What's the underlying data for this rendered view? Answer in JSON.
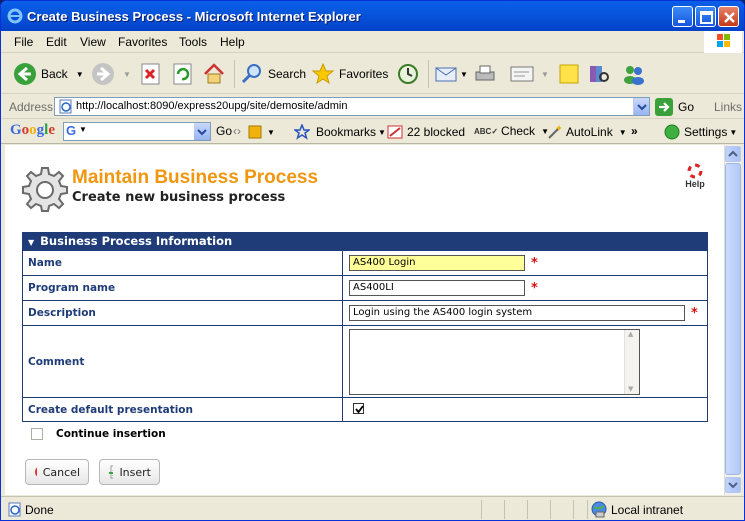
{
  "window": {
    "title": "Create Business Process - Microsoft Internet Explorer"
  },
  "menu": [
    "File",
    "Edit",
    "View",
    "Favorites",
    "Tools",
    "Help"
  ],
  "toolbar": {
    "back": "Back",
    "search": "Search",
    "favorites": "Favorites"
  },
  "address": {
    "label": "Address",
    "url": "http://localhost:8090/express20upg/site/demosite/admin",
    "go": "Go",
    "links": "Links"
  },
  "google": {
    "logo": "Google",
    "go": "Go",
    "bookmarks": "Bookmarks",
    "blocked": "22 blocked",
    "check": "Check",
    "autolink": "AutoLink",
    "settings": "Settings"
  },
  "page": {
    "title": "Maintain Business Process",
    "subtitle": "Create new business process",
    "help": "Help",
    "section": "Business Process Information",
    "fields": {
      "name_label": "Name",
      "name_value": "AS400 Login",
      "program_label": "Program name",
      "program_value": "AS400LI",
      "description_label": "Description",
      "description_value": "Login using the AS400 login system",
      "comment_label": "Comment",
      "comment_value": "",
      "presentation_label": "Create default presentation",
      "presentation_checked": true
    },
    "continue_label": "Continue insertion",
    "continue_checked": false,
    "cancel": "Cancel",
    "insert": "Insert",
    "required_mark": "*"
  },
  "status": {
    "text": "Done",
    "zone": "Local intranet"
  },
  "colors": {
    "accent": "#f0960f",
    "header": "#1f3c78",
    "highlight_input": "#ffff99",
    "required": "#d21010"
  }
}
